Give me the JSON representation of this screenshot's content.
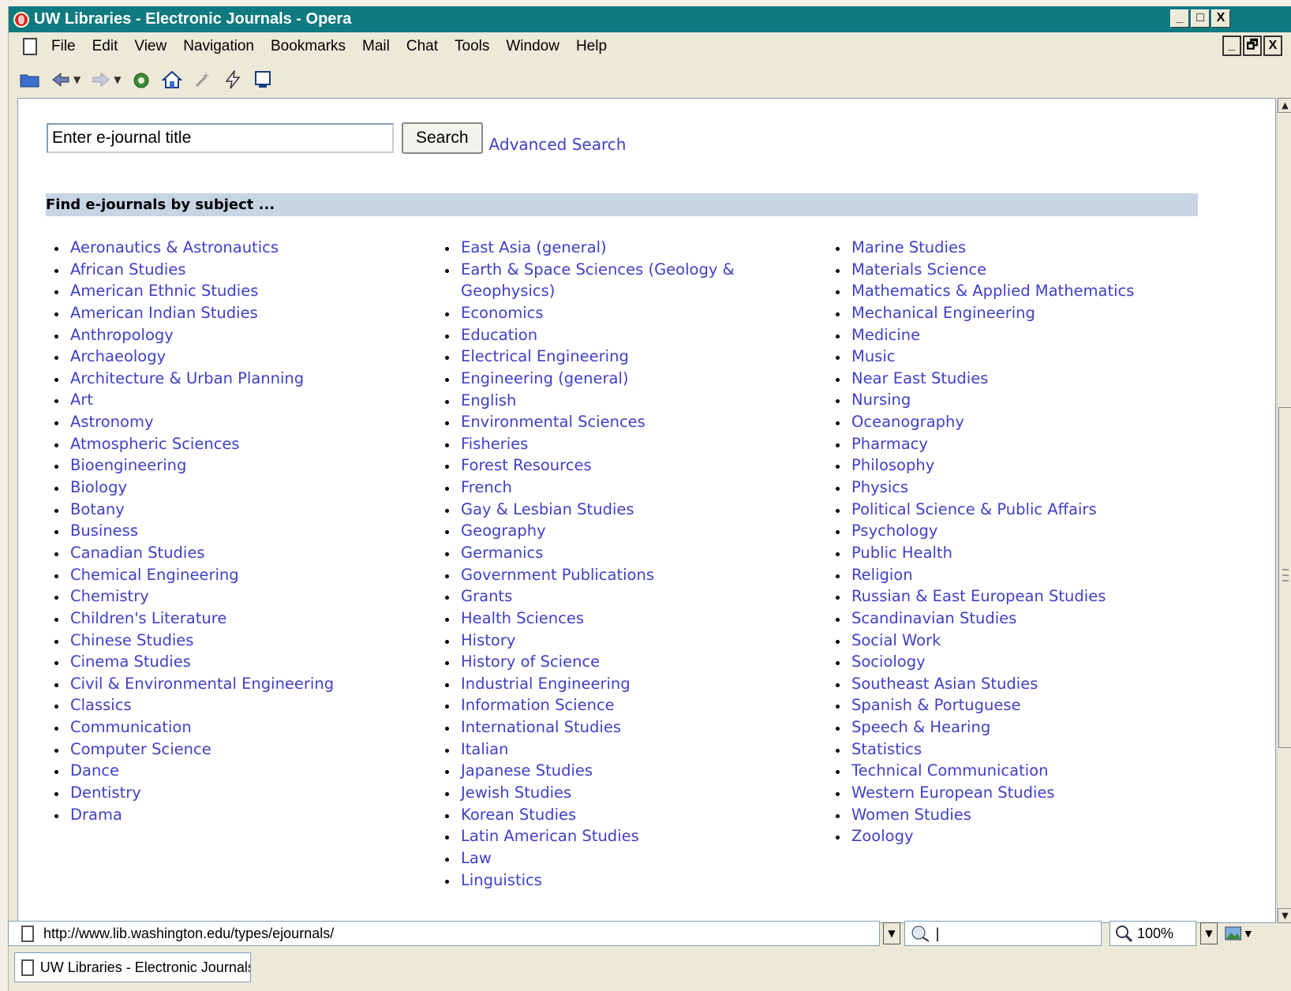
{
  "window": {
    "title": "UW Libraries - Electronic Journals - Opera",
    "controls": [
      "_",
      "□",
      "X"
    ],
    "mdi_controls": [
      "_",
      "🗗",
      "X"
    ]
  },
  "menu": [
    "File",
    "Edit",
    "View",
    "Navigation",
    "Bookmarks",
    "Mail",
    "Chat",
    "Tools",
    "Window",
    "Help"
  ],
  "search": {
    "value": "Enter e-journal title",
    "button_label": "Search",
    "advanced_label": "Advanced Search"
  },
  "subject_heading": "Find e-journals by subject ...",
  "subjects": {
    "col1": [
      "Aeronautics & Astronautics",
      "African Studies",
      "American Ethnic Studies",
      "American Indian Studies",
      "Anthropology",
      "Archaeology",
      "Architecture & Urban Planning",
      "Art",
      "Astronomy",
      "Atmospheric Sciences",
      "Bioengineering",
      "Biology",
      "Botany",
      "Business",
      "Canadian Studies",
      "Chemical Engineering",
      "Chemistry",
      "Children's Literature",
      "Chinese Studies",
      "Cinema Studies",
      "Civil & Environmental Engineering",
      "Classics",
      "Communication",
      "Computer Science",
      "Dance",
      "Dentistry",
      "Drama"
    ],
    "col2": [
      "East Asia (general)",
      "Earth & Space Sciences (Geology & Geophysics)",
      "Economics",
      "Education",
      "Electrical Engineering",
      "Engineering (general)",
      "English",
      "Environmental Sciences",
      "Fisheries",
      "Forest Resources",
      "French",
      "Gay & Lesbian Studies",
      "Geography",
      "Germanics",
      "Government Publications",
      "Grants",
      "Health Sciences",
      "History",
      "History of Science",
      "Industrial Engineering",
      "Information Science",
      "International Studies",
      "Italian",
      "Japanese Studies",
      "Jewish Studies",
      "Korean Studies",
      "Latin American Studies",
      "Law",
      "Linguistics"
    ],
    "col3": [
      "Marine Studies",
      "Materials Science",
      "Mathematics & Applied Mathematics",
      "Mechanical Engineering",
      "Medicine",
      "Music",
      "Near East Studies",
      "Nursing",
      "Oceanography",
      "Pharmacy",
      "Philosophy",
      "Physics",
      "Political Science & Public Affairs",
      "Psychology",
      "Public Health",
      "Religion",
      "Russian & East European Studies",
      "Scandinavian Studies",
      "Social Work",
      "Sociology",
      "Southeast Asian Studies",
      "Spanish & Portuguese",
      "Speech & Hearing",
      "Statistics",
      "Technical Communication",
      "Western European Studies",
      "Women Studies",
      "Zoology"
    ]
  },
  "status": {
    "url": "http://www.lib.washington.edu/types/ejournals/",
    "zoom": "100%"
  },
  "tab": {
    "label": "UW Libraries - Electronic Journals"
  },
  "colors": {
    "title_bar": "#0f7a80",
    "link": "#3f40c7",
    "subject_bar": "#c7d4e4"
  }
}
